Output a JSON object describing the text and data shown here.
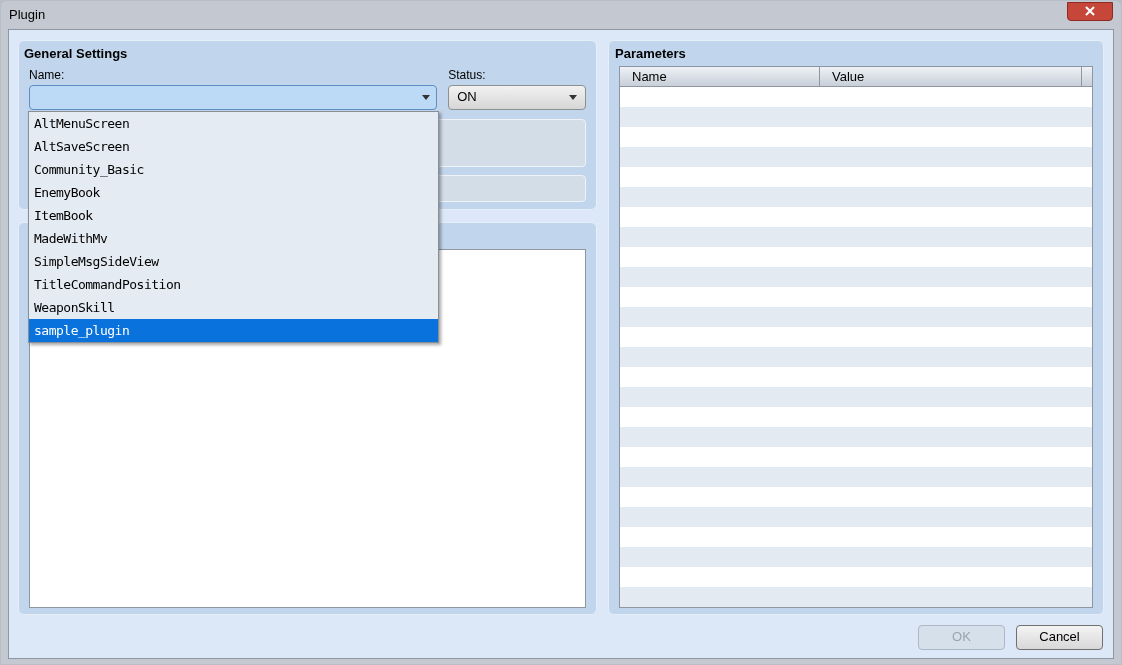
{
  "window": {
    "title": "Plugin"
  },
  "general_settings": {
    "title": "General Settings",
    "name_label": "Name:",
    "status_label": "Status:",
    "status_value": "ON",
    "name_options": [
      {
        "label": "AltMenuScreen",
        "selected": false
      },
      {
        "label": "AltSaveScreen",
        "selected": false
      },
      {
        "label": "Community_Basic",
        "selected": false
      },
      {
        "label": "EnemyBook",
        "selected": false
      },
      {
        "label": "ItemBook",
        "selected": false
      },
      {
        "label": "MadeWithMv",
        "selected": false
      },
      {
        "label": "SimpleMsgSideView",
        "selected": false
      },
      {
        "label": "TitleCommandPosition",
        "selected": false
      },
      {
        "label": "WeaponSkill",
        "selected": false
      },
      {
        "label": "sample_plugin",
        "selected": true
      }
    ]
  },
  "parameters": {
    "title": "Parameters",
    "columns": [
      "Name",
      "Value"
    ]
  },
  "buttons": [
    {
      "label": "OK",
      "disabled": true
    },
    {
      "label": "Cancel",
      "disabled": false
    }
  ]
}
